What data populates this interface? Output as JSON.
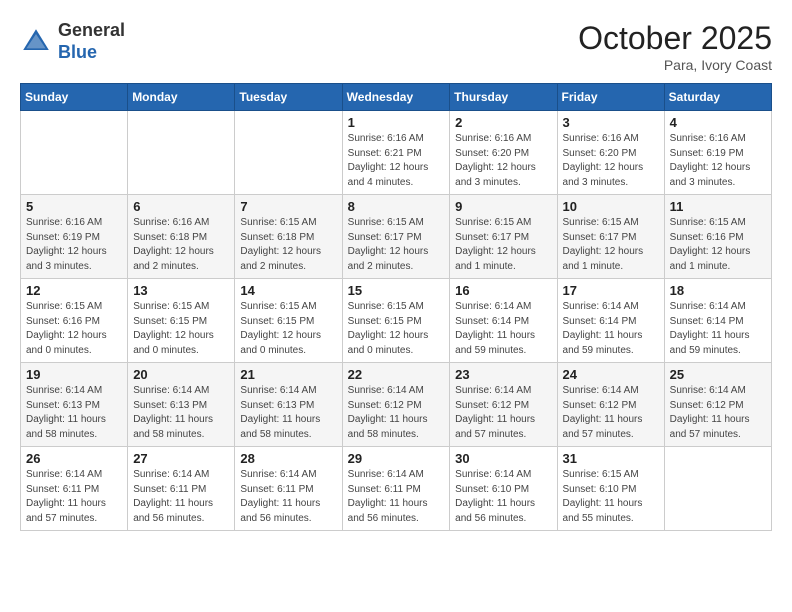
{
  "header": {
    "logo_general": "General",
    "logo_blue": "Blue",
    "month_title": "October 2025",
    "location": "Para, Ivory Coast"
  },
  "weekdays": [
    "Sunday",
    "Monday",
    "Tuesday",
    "Wednesday",
    "Thursday",
    "Friday",
    "Saturday"
  ],
  "weeks": [
    [
      {
        "day": "",
        "info": ""
      },
      {
        "day": "",
        "info": ""
      },
      {
        "day": "",
        "info": ""
      },
      {
        "day": "1",
        "info": "Sunrise: 6:16 AM\nSunset: 6:21 PM\nDaylight: 12 hours\nand 4 minutes."
      },
      {
        "day": "2",
        "info": "Sunrise: 6:16 AM\nSunset: 6:20 PM\nDaylight: 12 hours\nand 3 minutes."
      },
      {
        "day": "3",
        "info": "Sunrise: 6:16 AM\nSunset: 6:20 PM\nDaylight: 12 hours\nand 3 minutes."
      },
      {
        "day": "4",
        "info": "Sunrise: 6:16 AM\nSunset: 6:19 PM\nDaylight: 12 hours\nand 3 minutes."
      }
    ],
    [
      {
        "day": "5",
        "info": "Sunrise: 6:16 AM\nSunset: 6:19 PM\nDaylight: 12 hours\nand 3 minutes."
      },
      {
        "day": "6",
        "info": "Sunrise: 6:16 AM\nSunset: 6:18 PM\nDaylight: 12 hours\nand 2 minutes."
      },
      {
        "day": "7",
        "info": "Sunrise: 6:15 AM\nSunset: 6:18 PM\nDaylight: 12 hours\nand 2 minutes."
      },
      {
        "day": "8",
        "info": "Sunrise: 6:15 AM\nSunset: 6:17 PM\nDaylight: 12 hours\nand 2 minutes."
      },
      {
        "day": "9",
        "info": "Sunrise: 6:15 AM\nSunset: 6:17 PM\nDaylight: 12 hours\nand 1 minute."
      },
      {
        "day": "10",
        "info": "Sunrise: 6:15 AM\nSunset: 6:17 PM\nDaylight: 12 hours\nand 1 minute."
      },
      {
        "day": "11",
        "info": "Sunrise: 6:15 AM\nSunset: 6:16 PM\nDaylight: 12 hours\nand 1 minute."
      }
    ],
    [
      {
        "day": "12",
        "info": "Sunrise: 6:15 AM\nSunset: 6:16 PM\nDaylight: 12 hours\nand 0 minutes."
      },
      {
        "day": "13",
        "info": "Sunrise: 6:15 AM\nSunset: 6:15 PM\nDaylight: 12 hours\nand 0 minutes."
      },
      {
        "day": "14",
        "info": "Sunrise: 6:15 AM\nSunset: 6:15 PM\nDaylight: 12 hours\nand 0 minutes."
      },
      {
        "day": "15",
        "info": "Sunrise: 6:15 AM\nSunset: 6:15 PM\nDaylight: 12 hours\nand 0 minutes."
      },
      {
        "day": "16",
        "info": "Sunrise: 6:14 AM\nSunset: 6:14 PM\nDaylight: 11 hours\nand 59 minutes."
      },
      {
        "day": "17",
        "info": "Sunrise: 6:14 AM\nSunset: 6:14 PM\nDaylight: 11 hours\nand 59 minutes."
      },
      {
        "day": "18",
        "info": "Sunrise: 6:14 AM\nSunset: 6:14 PM\nDaylight: 11 hours\nand 59 minutes."
      }
    ],
    [
      {
        "day": "19",
        "info": "Sunrise: 6:14 AM\nSunset: 6:13 PM\nDaylight: 11 hours\nand 58 minutes."
      },
      {
        "day": "20",
        "info": "Sunrise: 6:14 AM\nSunset: 6:13 PM\nDaylight: 11 hours\nand 58 minutes."
      },
      {
        "day": "21",
        "info": "Sunrise: 6:14 AM\nSunset: 6:13 PM\nDaylight: 11 hours\nand 58 minutes."
      },
      {
        "day": "22",
        "info": "Sunrise: 6:14 AM\nSunset: 6:12 PM\nDaylight: 11 hours\nand 58 minutes."
      },
      {
        "day": "23",
        "info": "Sunrise: 6:14 AM\nSunset: 6:12 PM\nDaylight: 11 hours\nand 57 minutes."
      },
      {
        "day": "24",
        "info": "Sunrise: 6:14 AM\nSunset: 6:12 PM\nDaylight: 11 hours\nand 57 minutes."
      },
      {
        "day": "25",
        "info": "Sunrise: 6:14 AM\nSunset: 6:12 PM\nDaylight: 11 hours\nand 57 minutes."
      }
    ],
    [
      {
        "day": "26",
        "info": "Sunrise: 6:14 AM\nSunset: 6:11 PM\nDaylight: 11 hours\nand 57 minutes."
      },
      {
        "day": "27",
        "info": "Sunrise: 6:14 AM\nSunset: 6:11 PM\nDaylight: 11 hours\nand 56 minutes."
      },
      {
        "day": "28",
        "info": "Sunrise: 6:14 AM\nSunset: 6:11 PM\nDaylight: 11 hours\nand 56 minutes."
      },
      {
        "day": "29",
        "info": "Sunrise: 6:14 AM\nSunset: 6:11 PM\nDaylight: 11 hours\nand 56 minutes."
      },
      {
        "day": "30",
        "info": "Sunrise: 6:14 AM\nSunset: 6:10 PM\nDaylight: 11 hours\nand 56 minutes."
      },
      {
        "day": "31",
        "info": "Sunrise: 6:15 AM\nSunset: 6:10 PM\nDaylight: 11 hours\nand 55 minutes."
      },
      {
        "day": "",
        "info": ""
      }
    ]
  ]
}
